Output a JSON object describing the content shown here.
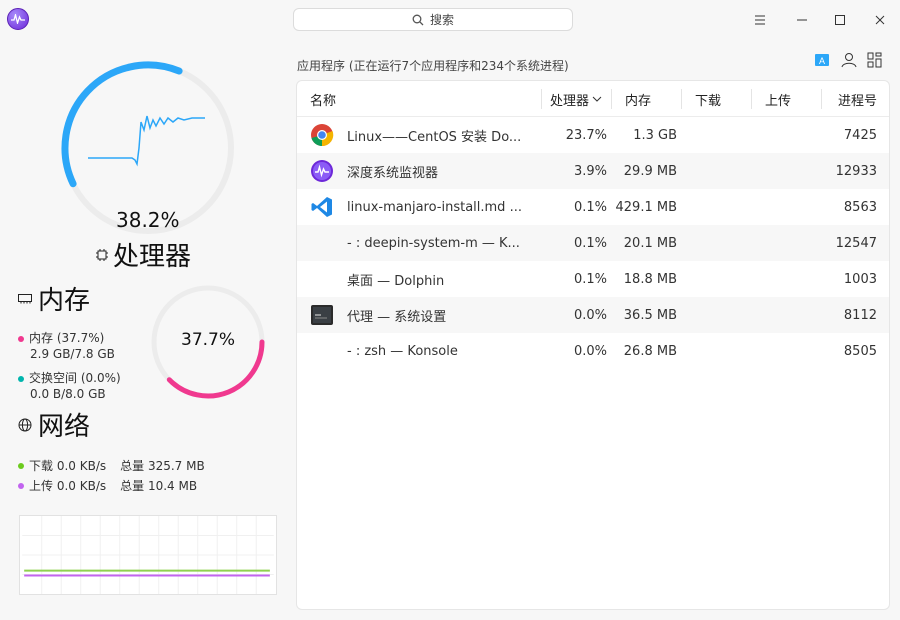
{
  "header": {
    "search_placeholder": "搜索"
  },
  "cpu": {
    "percent": "38.2%",
    "percent_value": 38.2,
    "title": "处理器"
  },
  "memory": {
    "title": "内存",
    "percent": "37.7%",
    "percent_value": 37.7,
    "mem_label": "内存 (37.7%)",
    "mem_value": "2.9 GB/7.8 GB",
    "swap_label": "交换空间 (0.0%)",
    "swap_value": "0.0 B/8.0 GB"
  },
  "network": {
    "title": "网络",
    "download_label": "下载 0.0 KB/s",
    "download_total": "总量 325.7 MB",
    "upload_label": "上传 0.0 KB/s",
    "upload_total": "总量 10.4 MB"
  },
  "colors": {
    "cpu": "#2ca7f8",
    "memory": "#f0398f",
    "swap": "#00b5ad",
    "download": "#6ccb1e",
    "upload": "#c264ef"
  },
  "process_summary": "应用程序 (正在运行7个应用程序和234个系统进程)",
  "table": {
    "columns": {
      "name": "名称",
      "cpu": "处理器",
      "memory": "内存",
      "download": "下载",
      "upload": "上传",
      "pid": "进程号"
    },
    "rows": [
      {
        "icon": "chrome-icon",
        "name": "Linux——CentOS 安装 Do...",
        "cpu": "23.7%",
        "memory": "1.3 GB",
        "download": "",
        "upload": "",
        "pid": "7425"
      },
      {
        "icon": "deepin-monitor-icon",
        "name": "深度系统监视器",
        "cpu": "3.9%",
        "memory": "29.9 MB",
        "download": "",
        "upload": "",
        "pid": "12933"
      },
      {
        "icon": "vscode-icon",
        "name": "linux-manjaro-install.md ...",
        "cpu": "0.1%",
        "memory": "429.1 MB",
        "download": "",
        "upload": "",
        "pid": "8563"
      },
      {
        "icon": "",
        "name": "- : deepin-system-m — K...",
        "cpu": "0.1%",
        "memory": "20.1 MB",
        "download": "",
        "upload": "",
        "pid": "12547"
      },
      {
        "icon": "",
        "name": "桌面 — Dolphin",
        "cpu": "0.1%",
        "memory": "18.8 MB",
        "download": "",
        "upload": "",
        "pid": "1003"
      },
      {
        "icon": "terminal-icon",
        "name": "代理 — 系统设置",
        "cpu": "0.0%",
        "memory": "36.5 MB",
        "download": "",
        "upload": "",
        "pid": "8112"
      },
      {
        "icon": "",
        "name": "- : zsh — Konsole",
        "cpu": "0.0%",
        "memory": "26.8 MB",
        "download": "",
        "upload": "",
        "pid": "8505"
      }
    ]
  }
}
